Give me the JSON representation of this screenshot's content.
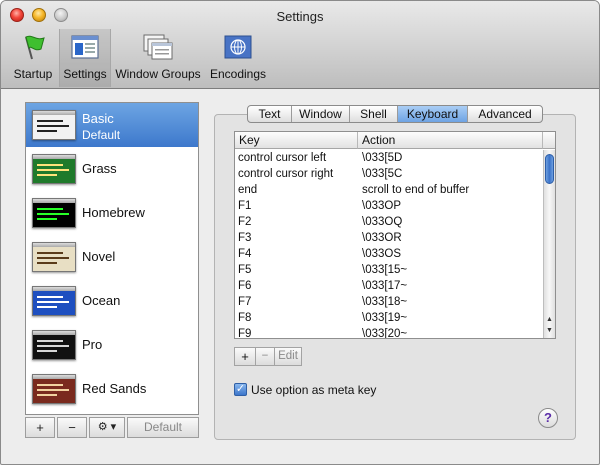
{
  "window": {
    "title": "Settings"
  },
  "toolbar": {
    "items": [
      {
        "label": "Startup",
        "icon": "green-flag-icon"
      },
      {
        "label": "Settings",
        "icon": "settings-window-icon",
        "selected": true
      },
      {
        "label": "Window Groups",
        "icon": "window-groups-icon"
      },
      {
        "label": "Encodings",
        "icon": "globe-flag-icon"
      }
    ]
  },
  "profiles": {
    "items": [
      {
        "name": "Basic",
        "subtitle": "Default",
        "selected": true,
        "colors": {
          "bg": "#f2f2f2",
          "text": "#222222"
        }
      },
      {
        "name": "Grass",
        "colors": {
          "bg": "#1f7a2b",
          "text": "#ffe37a"
        }
      },
      {
        "name": "Homebrew",
        "colors": {
          "bg": "#000000",
          "text": "#28ff28"
        }
      },
      {
        "name": "Novel",
        "colors": {
          "bg": "#e8dfc4",
          "text": "#5a3b1a"
        }
      },
      {
        "name": "Ocean",
        "colors": {
          "bg": "#1e4fc0",
          "text": "#ffffff"
        }
      },
      {
        "name": "Pro",
        "colors": {
          "bg": "#111111",
          "text": "#d8d8d8"
        }
      },
      {
        "name": "Red Sands",
        "colors": {
          "bg": "#7a2a1e",
          "text": "#f2d2a0"
        }
      }
    ],
    "buttons": {
      "add": "+",
      "remove": "−",
      "action": "⚙ ▾",
      "default": "Default"
    }
  },
  "tabs": {
    "items": [
      "Text",
      "Window",
      "Shell",
      "Keyboard",
      "Advanced"
    ],
    "selected": "Keyboard"
  },
  "keyboard": {
    "columns": {
      "key": "Key",
      "action": "Action"
    },
    "rows": [
      {
        "key": "control cursor left",
        "action": "\\033[5D"
      },
      {
        "key": "control cursor right",
        "action": "\\033[5C"
      },
      {
        "key": "end",
        "action": "scroll to end of buffer"
      },
      {
        "key": "F1",
        "action": "\\033OP"
      },
      {
        "key": "F2",
        "action": "\\033OQ"
      },
      {
        "key": "F3",
        "action": "\\033OR"
      },
      {
        "key": "F4",
        "action": "\\033OS"
      },
      {
        "key": "F5",
        "action": "\\033[15~"
      },
      {
        "key": "F6",
        "action": "\\033[17~"
      },
      {
        "key": "F7",
        "action": "\\033[18~"
      },
      {
        "key": "F8",
        "action": "\\033[19~"
      },
      {
        "key": "F9",
        "action": "\\033[20~"
      }
    ],
    "buttons": {
      "add": "+",
      "remove": "−",
      "edit": "Edit"
    },
    "option_meta": {
      "label": "Use option as meta key",
      "checked": true
    }
  },
  "help": {
    "label": "?"
  },
  "colors": {
    "accent": "#3d78cc",
    "selection": "#6da5e3"
  }
}
